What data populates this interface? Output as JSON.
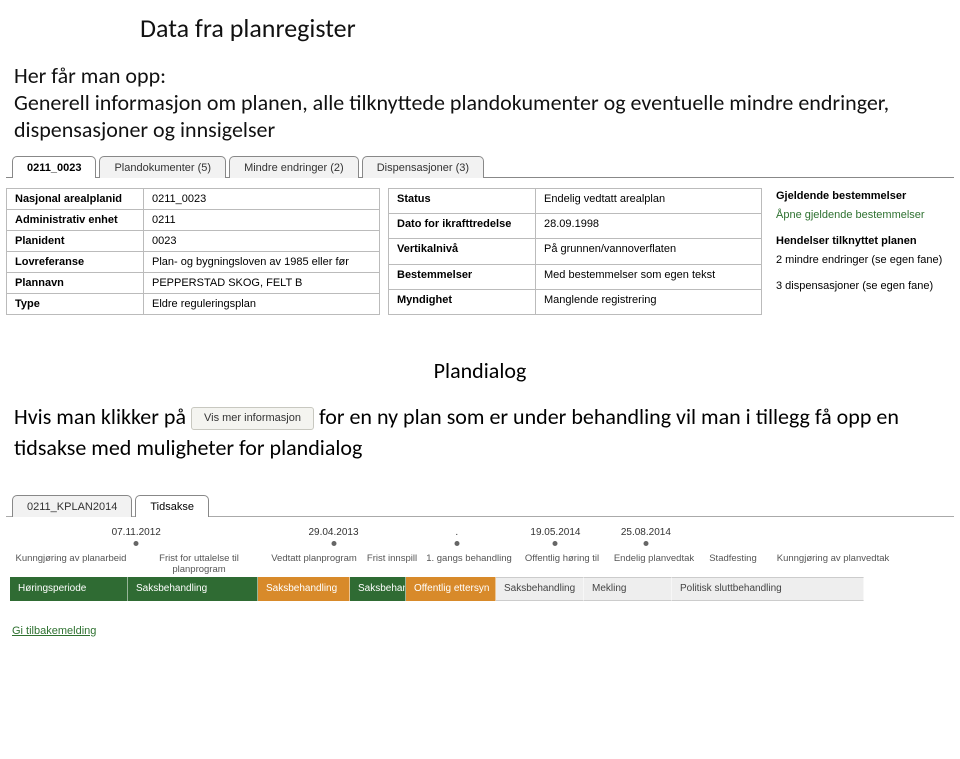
{
  "title": "Data fra planregister",
  "intro_prefix": "Her får man opp:",
  "intro_body": "Generell informasjon om planen, alle tilknyttede plandokumenter og eventuelle mindre endringer, dispensasjoner og innsigelser",
  "tabs": [
    {
      "label": "0211_0023",
      "active": true
    },
    {
      "label": "Plandokumenter (5)",
      "active": false
    },
    {
      "label": "Mindre endringer (2)",
      "active": false
    },
    {
      "label": "Dispensasjoner (3)",
      "active": false
    }
  ],
  "details_left": [
    {
      "label": "Nasjonal arealplanid",
      "value": "0211_0023"
    },
    {
      "label": "Administrativ enhet",
      "value": "0211"
    },
    {
      "label": "Planident",
      "value": "0023"
    },
    {
      "label": "Lovreferanse",
      "value": "Plan- og bygningsloven av 1985 eller før"
    },
    {
      "label": "Plannavn",
      "value": "PEPPERSTAD SKOG, FELT B"
    },
    {
      "label": "Type",
      "value": "Eldre reguleringsplan"
    }
  ],
  "details_right": [
    {
      "label": "Status",
      "value": "Endelig vedtatt arealplan"
    },
    {
      "label": "Dato for ikrafttredelse",
      "value": "28.09.1998"
    },
    {
      "label": "Vertikalnivå",
      "value": "På grunnen/vannoverflaten"
    },
    {
      "label": "Bestemmelser",
      "value": "Med bestemmelser som egen tekst"
    },
    {
      "label": "Myndighet",
      "value": "Manglende registrering"
    }
  ],
  "side_info": {
    "gjeldende_title": "Gjeldende bestemmelser",
    "gjeldende_link": "Åpne gjeldende bestemmelser",
    "hendelser_title": "Hendelser tilknyttet planen",
    "hendelser_line1": "2 mindre endringer (se egen fane)",
    "hendelser_line2": "3 dispensasjoner (se egen fane)"
  },
  "plandialog_heading": "Plandialog",
  "mid_line_prefix": "Hvis man klikker på",
  "vis_mer_label": "Vis mer informasjon",
  "mid_line_suffix": "for en ny plan som er under behandling vil man i tillegg få opp en tidsakse med muligheter for plandialog",
  "tabs2": [
    {
      "label": "0211_KPLAN2014",
      "active": false
    },
    {
      "label": "Tidsakse",
      "active": true
    }
  ],
  "timeline": {
    "dates": [
      {
        "text": "07.11.2012",
        "pos": 1
      },
      {
        "text": "29.04.2013",
        "pos": 25
      },
      {
        "text": ".",
        "pos": 40
      },
      {
        "text": "19.05.2014",
        "pos": 52
      },
      {
        "text": "25.08.2014",
        "pos": 63
      }
    ],
    "phase_labels": [
      {
        "text": "Kunngjøring av planarbeid",
        "w": 118
      },
      {
        "text": "Frist for uttalelse til planprogram",
        "w": 130
      },
      {
        "text": "Vedtatt planprogram",
        "w": 92
      },
      {
        "text": "Frist innspill",
        "w": 56
      },
      {
        "text": "1. gangs behandling",
        "w": 90
      },
      {
        "text": "Offentlig høring til",
        "w": 88
      },
      {
        "text": "Endelig planvedtak",
        "w": 88
      },
      {
        "text": "Stadfesting",
        "w": 62
      },
      {
        "text": "Kunngjøring av planvedtak",
        "w": 130
      }
    ],
    "phase_bars": [
      {
        "text": "Høringsperiode",
        "w": 118,
        "class": "bar-green"
      },
      {
        "text": "Saksbehandling",
        "w": 130,
        "class": "bar-green"
      },
      {
        "text": "Saksbehandling",
        "w": 92,
        "class": "bar-orange"
      },
      {
        "text": "Saksbehandling",
        "w": 56,
        "class": "bar-green"
      },
      {
        "text": "Offentlig ettersyn",
        "w": 90,
        "class": "bar-orange"
      },
      {
        "text": "Saksbehandling",
        "w": 88,
        "class": "bar-gray"
      },
      {
        "text": "Mekling",
        "w": 88,
        "class": "bar-gray"
      },
      {
        "text": "Politisk sluttbehandling",
        "w": 192,
        "class": "bar-gray"
      }
    ]
  },
  "gi_tilbakemelding": "Gi tilbakemelding"
}
